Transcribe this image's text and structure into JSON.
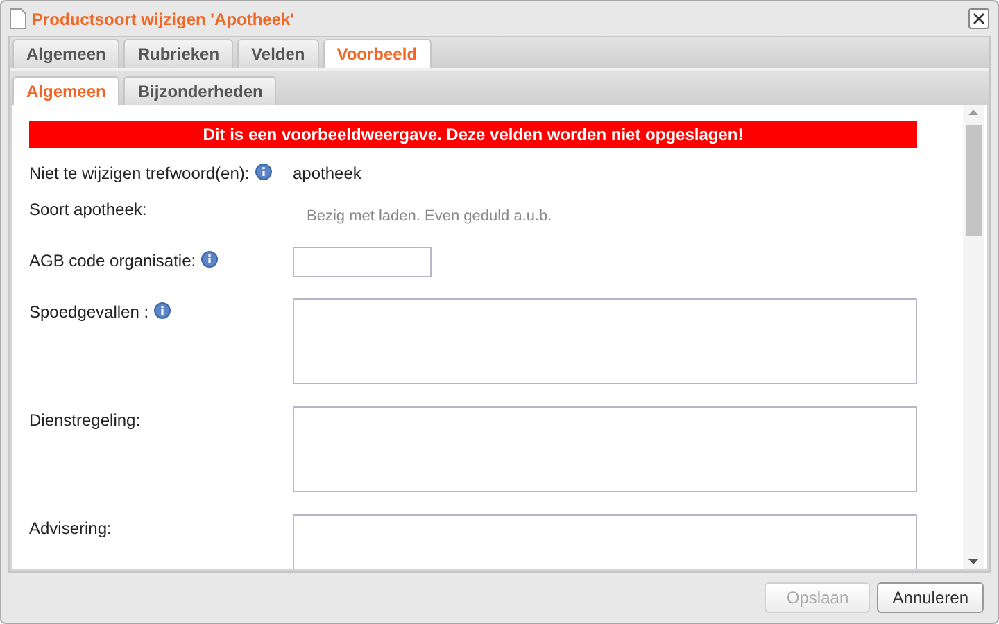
{
  "window": {
    "title": "Productsoort wijzigen 'Apotheek'"
  },
  "tabs": [
    {
      "label": "Algemeen",
      "selected": false
    },
    {
      "label": "Rubrieken",
      "selected": false
    },
    {
      "label": "Velden",
      "selected": false
    },
    {
      "label": "Voorbeeld",
      "selected": true
    }
  ],
  "subtabs": [
    {
      "label": "Algemeen",
      "selected": true
    },
    {
      "label": "Bijzonderheden",
      "selected": false
    }
  ],
  "banner": "Dit is een voorbeeldweergave. Deze velden worden niet opgeslagen!",
  "fields": [
    {
      "kind": "text",
      "label": "Niet te wijzigen trefwoord(en):",
      "info": true,
      "value": "apotheek"
    },
    {
      "kind": "loading",
      "label": "Soort apotheek:",
      "info": false,
      "value": "Bezig met laden. Even geduld a.u.b."
    },
    {
      "kind": "input",
      "label": "AGB code organisatie:",
      "info": true
    },
    {
      "kind": "textarea",
      "label": "Spoedgevallen :",
      "info": true
    },
    {
      "kind": "textarea",
      "label": "Dienstregeling:",
      "info": false
    },
    {
      "kind": "textarea",
      "label": "Advisering:",
      "info": false
    }
  ],
  "buttons": [
    {
      "label": "Opslaan",
      "disabled": true
    },
    {
      "label": "Annuleren",
      "disabled": false
    }
  ]
}
